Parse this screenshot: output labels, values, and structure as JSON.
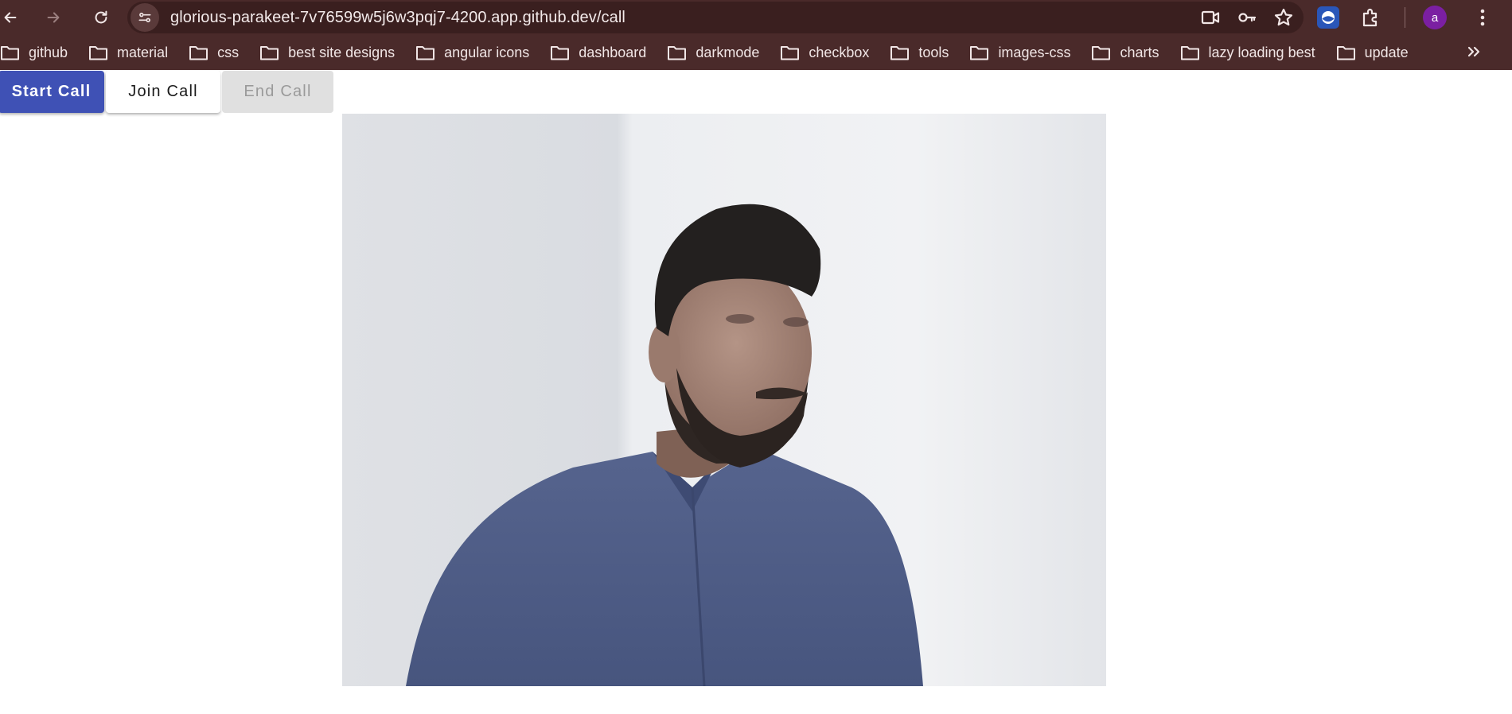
{
  "browser": {
    "url": "glorious-parakeet-7v76599w5j6w3pqj7-4200.app.github.dev/call",
    "avatar_letter": "a",
    "nav_icons": [
      "back-arrow-icon",
      "forward-arrow-icon",
      "reload-icon"
    ],
    "omnibox_icons": [
      "camera-in-use-icon",
      "password-key-icon",
      "bookmark-star-icon"
    ],
    "toolbar_icons": [
      "extension-icon",
      "puzzle-extensions-icon",
      "avatar",
      "kebab-menu-icon"
    ]
  },
  "bookmarks": [
    {
      "label": "github"
    },
    {
      "label": "material"
    },
    {
      "label": "css"
    },
    {
      "label": "best site designs"
    },
    {
      "label": "angular icons"
    },
    {
      "label": "dashboard"
    },
    {
      "label": "darkmode"
    },
    {
      "label": "checkbox"
    },
    {
      "label": "tools"
    },
    {
      "label": "images-css"
    },
    {
      "label": "charts"
    },
    {
      "label": "lazy loading best"
    },
    {
      "label": "update"
    }
  ],
  "call_controls": {
    "start_label": "Start Call",
    "join_label": "Join Call",
    "end_label": "End Call"
  },
  "colors": {
    "chrome_bg": "#4a2a2a",
    "primary": "#3f51b5",
    "disabled_bg": "#e0e0e0",
    "avatar_bg": "#7b1fa2"
  }
}
